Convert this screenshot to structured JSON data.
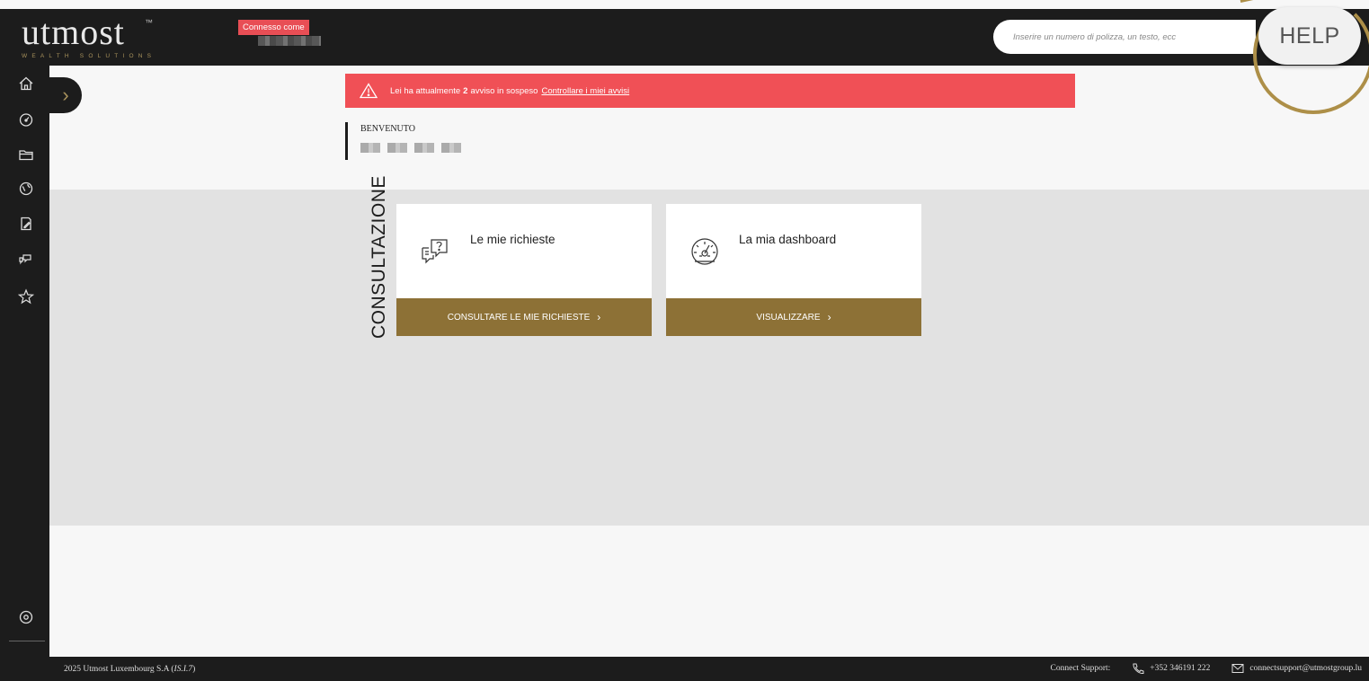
{
  "brand": {
    "name": "utmost",
    "tagline": "WEALTH SOLUTIONS",
    "tm": "™",
    "accent_color": "#8d7136",
    "dark_color": "#1c1c1c",
    "alert_color": "#f05056"
  },
  "header": {
    "connected_label": "Connesso come",
    "search_placeholder": "Inserire un numero di polizza, un testo, ecc",
    "help_label": "HELP"
  },
  "sidebar": {
    "items": [
      {
        "icon": "home-icon"
      },
      {
        "icon": "dashboard-gauge-icon"
      },
      {
        "icon": "folder-icon"
      },
      {
        "icon": "globe-icon"
      },
      {
        "icon": "document-edit-icon"
      },
      {
        "icon": "chat-icon"
      },
      {
        "icon": "star-icon"
      }
    ],
    "bottom": [
      {
        "icon": "settings-icon"
      },
      {
        "icon": "power-icon"
      }
    ],
    "expand_glyph": "›"
  },
  "alert": {
    "prefix": "Lei ha attualmente",
    "count": "2",
    "middle": "avviso in sospeso",
    "link": "Controllare i miei avvisi"
  },
  "welcome": {
    "label": "BENVENUTO"
  },
  "section": {
    "title": "CONSULTAZIONE"
  },
  "cards": [
    {
      "title": "Le mie richieste",
      "button": "CONSULTARE LE MIE RICHIESTE",
      "icon": "questions-chat-icon"
    },
    {
      "title": "La mia dashboard",
      "button": "VISUALIZZARE",
      "icon": "speedometer-icon"
    }
  ],
  "footer": {
    "copyright": "2025 Utmost Luxembourg S.A (",
    "copyright_italic": "IS.I.7",
    "copyright_end": ")",
    "support_label": "Connect Support:",
    "phone": "+352 346191 222",
    "email": "connectsupport@utmostgroup.lu"
  }
}
